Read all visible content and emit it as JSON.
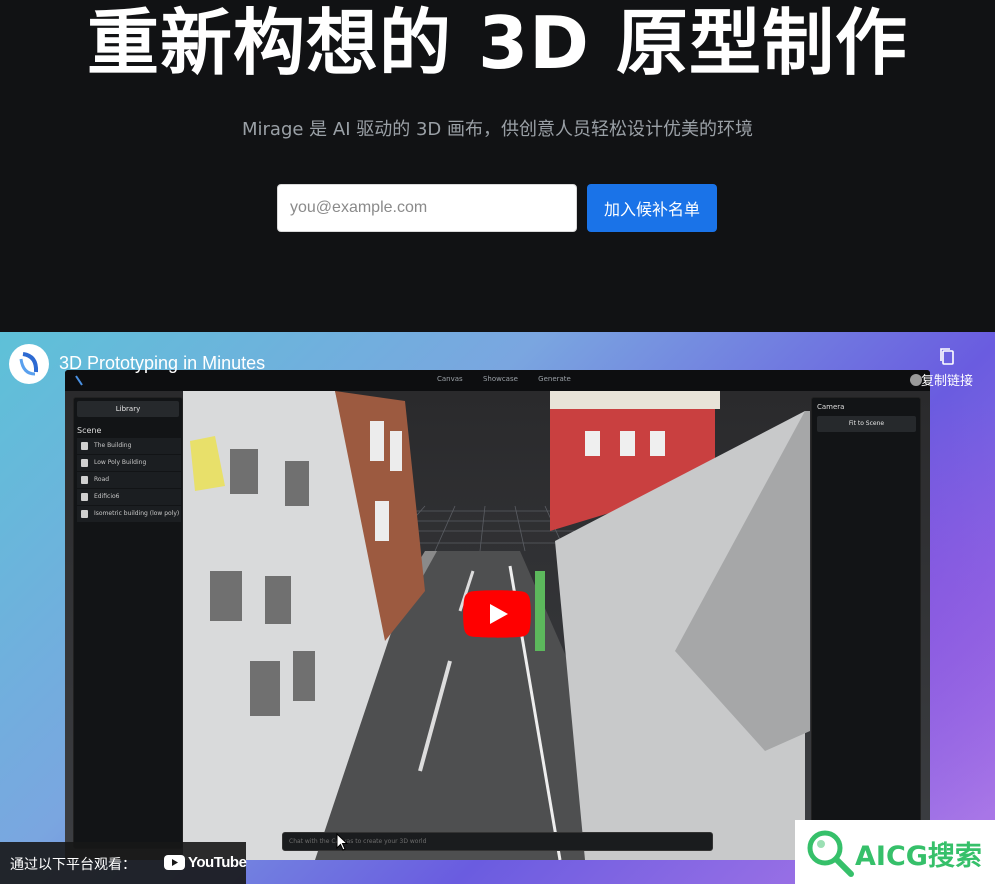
{
  "hero": {
    "title": "重新构想的 3D 原型制作",
    "subtitle": "Mirage 是 AI 驱动的 3D 画布，供创意人员轻松设计优美的环境",
    "email_placeholder": "you@example.com",
    "join_label": "加入候补名单"
  },
  "video": {
    "title": "3D Prototyping in Minutes",
    "copy_link_label": "复制链接",
    "watch_on_label": "通过以下平台观看：",
    "platform": "YouTube",
    "app": {
      "nav": [
        "Canvas",
        "Showcase",
        "Generate"
      ],
      "library_label": "Library",
      "scene_label": "Scene",
      "scene_items": [
        "The Building",
        "Low Poly Building",
        "Road",
        "Edificio6",
        "Isometric building (low poly)"
      ],
      "camera_label": "Camera",
      "fit_label": "Fit to Scene",
      "chat_placeholder": "Chat with the Canvas to create your 3D world"
    }
  },
  "watermark": {
    "text": "AICG搜索",
    "color": "#36c06a"
  },
  "colors": {
    "accent": "#1a73e8",
    "youtube_red": "#ff0000"
  }
}
